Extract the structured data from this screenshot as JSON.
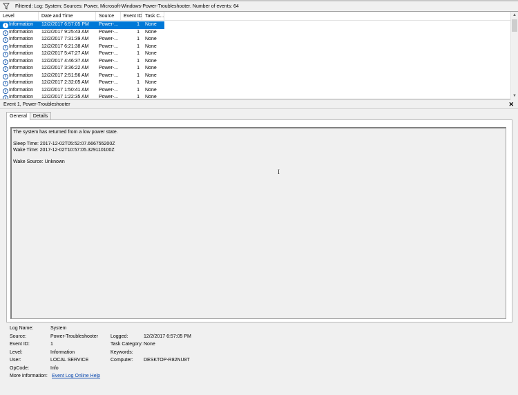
{
  "filter": {
    "icon": "funnel-icon",
    "text": "Filtered: Log: System; Sources: Power, Microsoft-Windows-Power-Troubleshooter. Number of events: 64"
  },
  "grid": {
    "columns": [
      "Level",
      "Date and Time",
      "Source",
      "Event ID",
      "Task C..."
    ],
    "rows": [
      {
        "level": "Information",
        "date": "12/2/2017 6:57:05 PM",
        "source": "Power-...",
        "id": "1",
        "task": "None",
        "selected": true
      },
      {
        "level": "Information",
        "date": "12/2/2017 9:25:43 AM",
        "source": "Power-...",
        "id": "1",
        "task": "None"
      },
      {
        "level": "Information",
        "date": "12/2/2017 7:31:39 AM",
        "source": "Power-...",
        "id": "1",
        "task": "None"
      },
      {
        "level": "Information",
        "date": "12/2/2017 6:21:38 AM",
        "source": "Power-...",
        "id": "1",
        "task": "None"
      },
      {
        "level": "Information",
        "date": "12/2/2017 5:47:27 AM",
        "source": "Power-...",
        "id": "1",
        "task": "None"
      },
      {
        "level": "Information",
        "date": "12/2/2017 4:46:37 AM",
        "source": "Power-...",
        "id": "1",
        "task": "None"
      },
      {
        "level": "Information",
        "date": "12/2/2017 3:36:22 AM",
        "source": "Power-...",
        "id": "1",
        "task": "None"
      },
      {
        "level": "Information",
        "date": "12/2/2017 2:51:56 AM",
        "source": "Power-...",
        "id": "1",
        "task": "None"
      },
      {
        "level": "Information",
        "date": "12/2/2017 2:32:05 AM",
        "source": "Power-...",
        "id": "1",
        "task": "None"
      },
      {
        "level": "Information",
        "date": "12/2/2017 1:50:41 AM",
        "source": "Power-...",
        "id": "1",
        "task": "None"
      },
      {
        "level": "Information",
        "date": "12/2/2017 1:22:35 AM",
        "source": "Power-...",
        "id": "1",
        "task": "None"
      }
    ]
  },
  "detail": {
    "title": "Event 1, Power-Troubleshooter",
    "close_glyph": "✕",
    "tabs": [
      "General",
      "Details"
    ],
    "message": {
      "line1": "The system has returned from a low power state.",
      "line2": "Sleep Time: 2017-12-02T05:52:07.666755200Z",
      "line3": "Wake Time: 2017-12-02T10:57:05.329110100Z",
      "line4": "Wake Source: Unknown"
    }
  },
  "properties": {
    "log_name_label": "Log Name:",
    "log_name": "System",
    "source_label": "Source:",
    "source": "Power-Troubleshooter",
    "logged_label": "Logged:",
    "logged": "12/2/2017 6:57:05 PM",
    "event_id_label": "Event ID:",
    "event_id": "1",
    "task_label": "Task Category:",
    "task": "None",
    "level_label": "Level:",
    "level": "Information",
    "keywords_label": "Keywords:",
    "keywords": "",
    "user_label": "User:",
    "user": "LOCAL SERVICE",
    "computer_label": "Computer:",
    "computer": "DESKTOP-R82NU8T",
    "opcode_label": "OpCode:",
    "opcode": "Info",
    "more_info_label": "More Information:",
    "more_info_link": "Event Log Online Help"
  },
  "colors": {
    "selection": "#0078d7",
    "link": "#0645ad"
  }
}
